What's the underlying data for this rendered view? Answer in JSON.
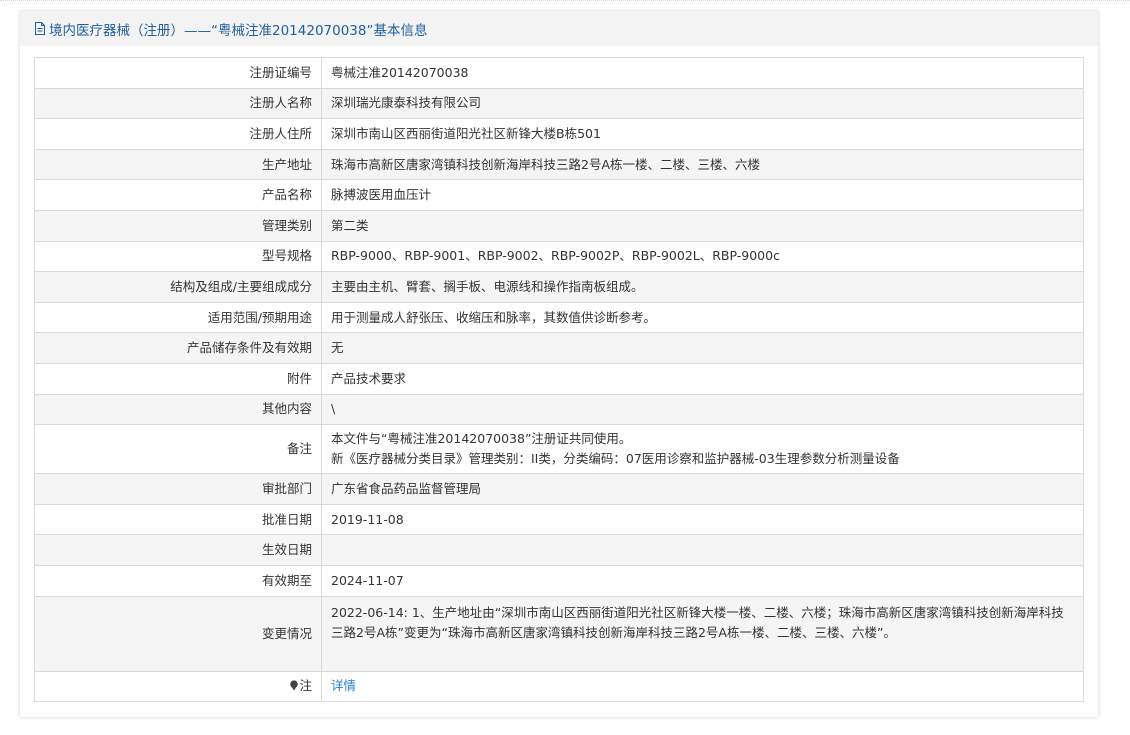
{
  "panel": {
    "title": "境内医疗器械（注册）——“粤械注准20142070038”基本信息"
  },
  "rows": [
    {
      "label": "注册证编号",
      "value": "粤械注准20142070038"
    },
    {
      "label": "注册人名称",
      "value": "深圳瑞光康泰科技有限公司"
    },
    {
      "label": "注册人住所",
      "value": "深圳市南山区西丽街道阳光社区新锋大楼B栋501"
    },
    {
      "label": "生产地址",
      "value": "珠海市高新区唐家湾镇科技创新海岸科技三路2号A栋一楼、二楼、三楼、六楼"
    },
    {
      "label": "产品名称",
      "value": "脉搏波医用血压计"
    },
    {
      "label": "管理类别",
      "value": "第二类"
    },
    {
      "label": "型号规格",
      "value": "RBP-9000、RBP-9001、RBP-9002、RBP-9002P、RBP-9002L、RBP-9000c"
    },
    {
      "label": "结构及组成/主要组成成分",
      "value": "主要由主机、臂套、搁手板、电源线和操作指南板组成。"
    },
    {
      "label": "适用范围/预期用途",
      "value": "用于测量成人舒张压、收缩压和脉率，其数值供诊断参考。"
    },
    {
      "label": "产品储存条件及有效期",
      "value": "无"
    },
    {
      "label": "附件",
      "value": "产品技术要求"
    },
    {
      "label": "其他内容",
      "value": "\\"
    },
    {
      "label": "备注",
      "value": "本文件与“粤械注准20142070038”注册证共同使用。\n新《医疗器械分类目录》管理类别：II类，分类编码：07医用诊察和监护器械-03生理参数分析测量设备"
    },
    {
      "label": "审批部门",
      "value": "广东省食品药品监督管理局"
    },
    {
      "label": "批准日期",
      "value": "2019-11-08"
    },
    {
      "label": "生效日期",
      "value": ""
    },
    {
      "label": "有效期至",
      "value": "2024-11-07"
    },
    {
      "label": "变更情况",
      "value": "2022-06-14: 1、生产地址由“深圳市南山区西丽街道阳光社区新锋大楼一楼、二楼、六楼；珠海市高新区唐家湾镇科技创新海岸科技三路2号A栋”变更为“珠海市高新区唐家湾镇科技创新海岸科技三路2号A栋一楼、二楼、三楼、六楼”。"
    },
    {
      "label": "注",
      "value": "详情"
    }
  ]
}
